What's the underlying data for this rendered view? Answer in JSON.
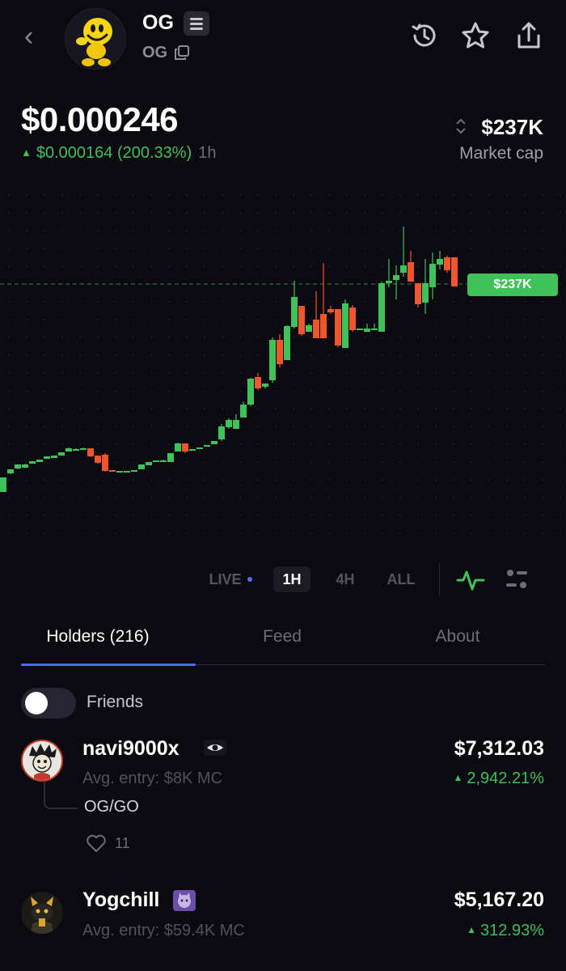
{
  "header": {
    "title": "OG",
    "ticker": "OG"
  },
  "price": {
    "value": "$0.000246",
    "change": "$0.000164 (200.33%)",
    "period": "1h"
  },
  "market_cap": {
    "value": "$237K",
    "label": "Market cap"
  },
  "chart": {
    "price_tag": "$237K",
    "up_color": "#40c25a",
    "down_color": "#f0552c"
  },
  "timeframes": {
    "live": "LIVE",
    "items": [
      "1H",
      "4H",
      "ALL"
    ],
    "selected": "1H"
  },
  "tabs": [
    "Holders (216)",
    "Feed",
    "About"
  ],
  "friends_toggle": {
    "label": "Friends",
    "on": false
  },
  "holders": [
    {
      "name": "navi9000x",
      "avg_entry": "Avg. entry: $8K MC",
      "value": "$7,312.03",
      "change": "2,942.21%",
      "comment": "OG/GO",
      "likes": "11"
    },
    {
      "name": "Yogchill",
      "avg_entry": "Avg. entry: $59.4K MC",
      "value": "$5,167.20",
      "change": "312.93%"
    }
  ]
}
